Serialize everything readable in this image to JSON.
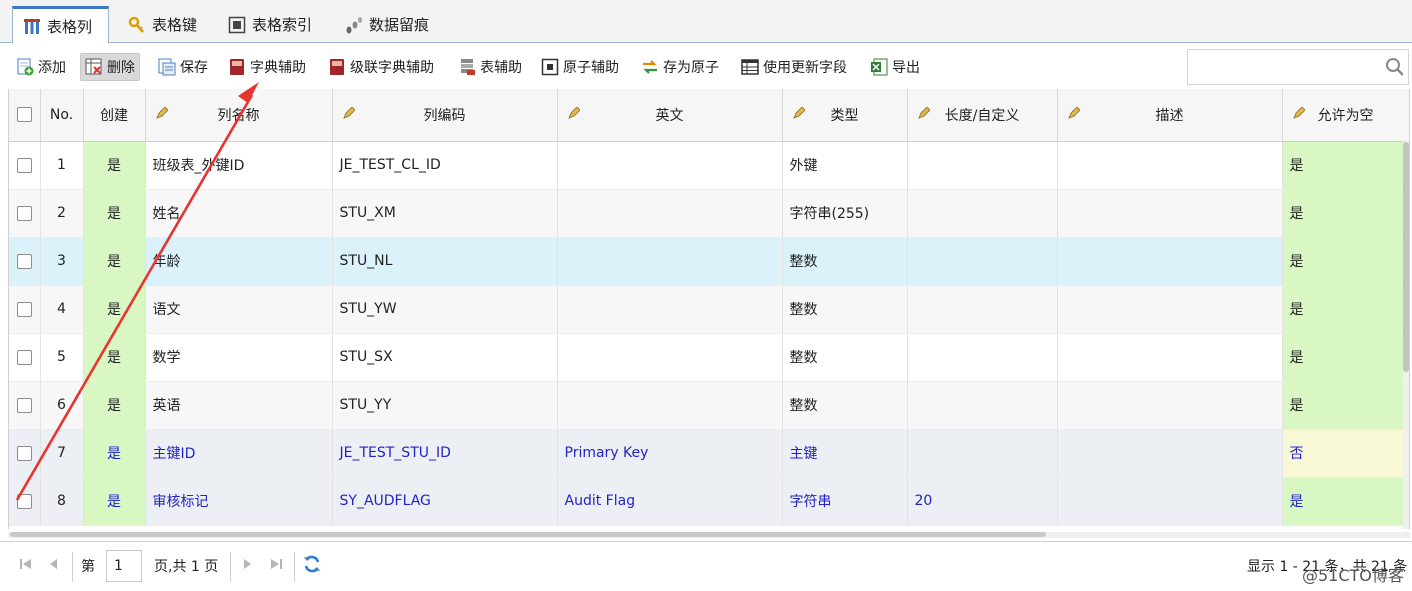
{
  "tabs": [
    {
      "label": "表格列",
      "icon": "column-icon",
      "active": true
    },
    {
      "label": "表格键",
      "icon": "key-icon",
      "active": false
    },
    {
      "label": "表格索引",
      "icon": "index-icon",
      "active": false
    },
    {
      "label": "数据留痕",
      "icon": "trace-icon",
      "active": false
    }
  ],
  "toolbar": {
    "add": "添加",
    "delete": "删除",
    "save": "保存",
    "dict_helper": "字典辅助",
    "cascade_dict_helper": "级联字典辅助",
    "table_helper": "表辅助",
    "atom_helper": "原子辅助",
    "save_as_atom": "存为原子",
    "use_update_field": "使用更新字段",
    "export": "导出"
  },
  "search": {
    "value": "",
    "placeholder": ""
  },
  "columns": [
    "No.",
    "创建",
    "列名称",
    "列编码",
    "英文",
    "类型",
    "长度/自定义",
    "描述",
    "允许为空"
  ],
  "rows": [
    {
      "no": "1",
      "create": "是",
      "name": "班级表_外键ID",
      "code": "JE_TEST_CL_ID",
      "english": "",
      "type": "外键",
      "length": "",
      "desc": "",
      "nullable": "是"
    },
    {
      "no": "2",
      "create": "是",
      "name": "姓名",
      "code": "STU_XM",
      "english": "",
      "type": "字符串(255)",
      "length": "",
      "desc": "",
      "nullable": "是"
    },
    {
      "no": "3",
      "create": "是",
      "name": "年龄",
      "code": "STU_NL",
      "english": "",
      "type": "整数",
      "length": "",
      "desc": "",
      "nullable": "是"
    },
    {
      "no": "4",
      "create": "是",
      "name": "语文",
      "code": "STU_YW",
      "english": "",
      "type": "整数",
      "length": "",
      "desc": "",
      "nullable": "是"
    },
    {
      "no": "5",
      "create": "是",
      "name": "数学",
      "code": "STU_SX",
      "english": "",
      "type": "整数",
      "length": "",
      "desc": "",
      "nullable": "是"
    },
    {
      "no": "6",
      "create": "是",
      "name": "英语",
      "code": "STU_YY",
      "english": "",
      "type": "整数",
      "length": "",
      "desc": "",
      "nullable": "是"
    },
    {
      "no": "7",
      "create": "是",
      "name": "主键ID",
      "code": "JE_TEST_STU_ID",
      "english": "Primary Key",
      "type": "主键",
      "length": "",
      "desc": "",
      "nullable": "否"
    },
    {
      "no": "8",
      "create": "是",
      "name": "审核标记",
      "code": "SY_AUDFLAG",
      "english": "Audit Flag",
      "type": "字符串",
      "length": "20",
      "desc": "",
      "nullable": "是"
    }
  ],
  "pager": {
    "page_prefix": "第",
    "current_page": "1",
    "page_suffix": "页,共 1 页",
    "summary": "显示 1 - 21 条，共 21 条"
  },
  "watermark": "@51CTO博客",
  "colors": {
    "accent": "#3a77c7",
    "green_cell": "#d9f7c2",
    "selected_row": "#dbf2fb",
    "annotation_arrow": "#e8332f",
    "link_text": "#2323c8"
  }
}
